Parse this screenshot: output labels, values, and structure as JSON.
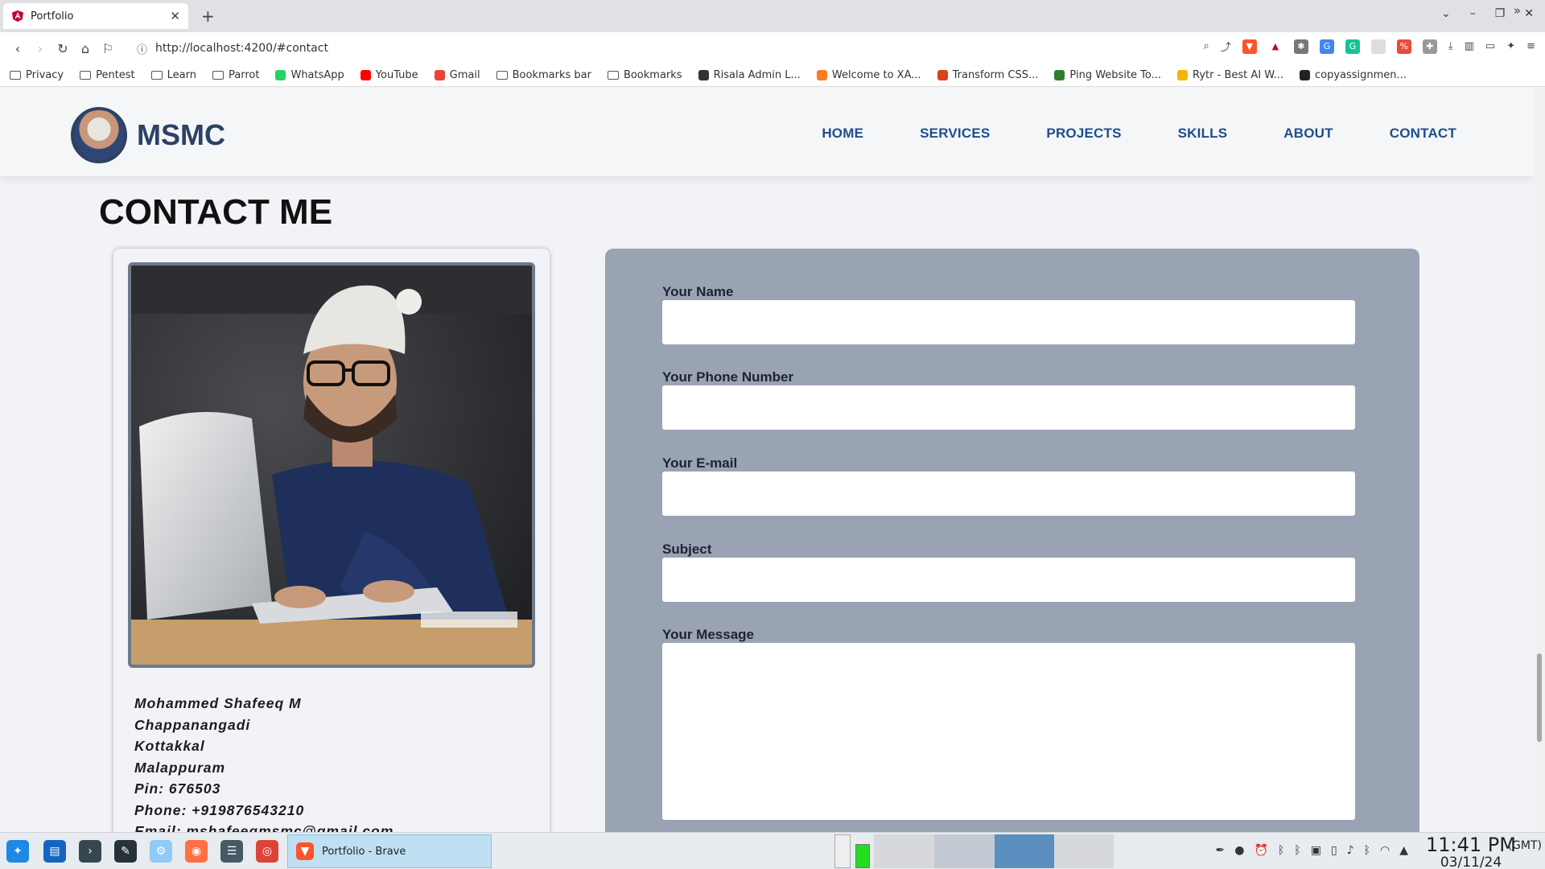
{
  "browser": {
    "tab_title": "Portfolio",
    "url": "http://localhost:4200/#contact",
    "bookmarks": [
      {
        "label": "Privacy",
        "icon": "folder-icon"
      },
      {
        "label": "Pentest",
        "icon": "folder-icon"
      },
      {
        "label": "Learn",
        "icon": "folder-icon"
      },
      {
        "label": "Parrot",
        "icon": "folder-icon"
      },
      {
        "label": "WhatsApp",
        "icon": "whatsapp-icon"
      },
      {
        "label": "YouTube",
        "icon": "youtube-icon"
      },
      {
        "label": "Gmail",
        "icon": "gmail-icon"
      },
      {
        "label": "Bookmarks bar",
        "icon": "folder-icon"
      },
      {
        "label": "Bookmarks",
        "icon": "folder-icon"
      },
      {
        "label": "Risala Admin L...",
        "icon": "globe-icon"
      },
      {
        "label": "Welcome to XA...",
        "icon": "xampp-icon"
      },
      {
        "label": "Transform CSS...",
        "icon": "css-icon"
      },
      {
        "label": "Ping Website To...",
        "icon": "ping-icon"
      },
      {
        "label": "Rytr - Best AI W...",
        "icon": "rytr-icon"
      },
      {
        "label": "copyassignmen...",
        "icon": "copy-icon"
      }
    ]
  },
  "site": {
    "brand": "MSMC",
    "nav": [
      "HOME",
      "SERVICES",
      "PROJECTS",
      "SKILLS",
      "ABOUT",
      "CONTACT"
    ],
    "section_title": "CONTACT ME",
    "address": [
      "Mohammed Shafeeq M",
      "Chappanangadi",
      "Kottakkal",
      "Malappuram",
      "Pin: 676503",
      "Phone: +919876543210",
      "Email: mshafeeqmsmc@gmail.com"
    ],
    "form": {
      "name_label": "Your Name",
      "phone_label": "Your Phone Number",
      "email_label": "Your E-mail",
      "subject_label": "Subject",
      "message_label": "Your Message",
      "name_value": "",
      "phone_value": "",
      "email_value": "",
      "subject_value": "",
      "message_value": ""
    }
  },
  "taskbar": {
    "active_task": "Portfolio - Brave",
    "time": "11:41 PM",
    "timezone": "(GMT)",
    "date": "03/11/24"
  },
  "colors": {
    "brand": "#2d4263",
    "nav_link": "#1f4e8c",
    "form_panel": "#9aa3b3",
    "page_bg": "#f1f3f6"
  }
}
